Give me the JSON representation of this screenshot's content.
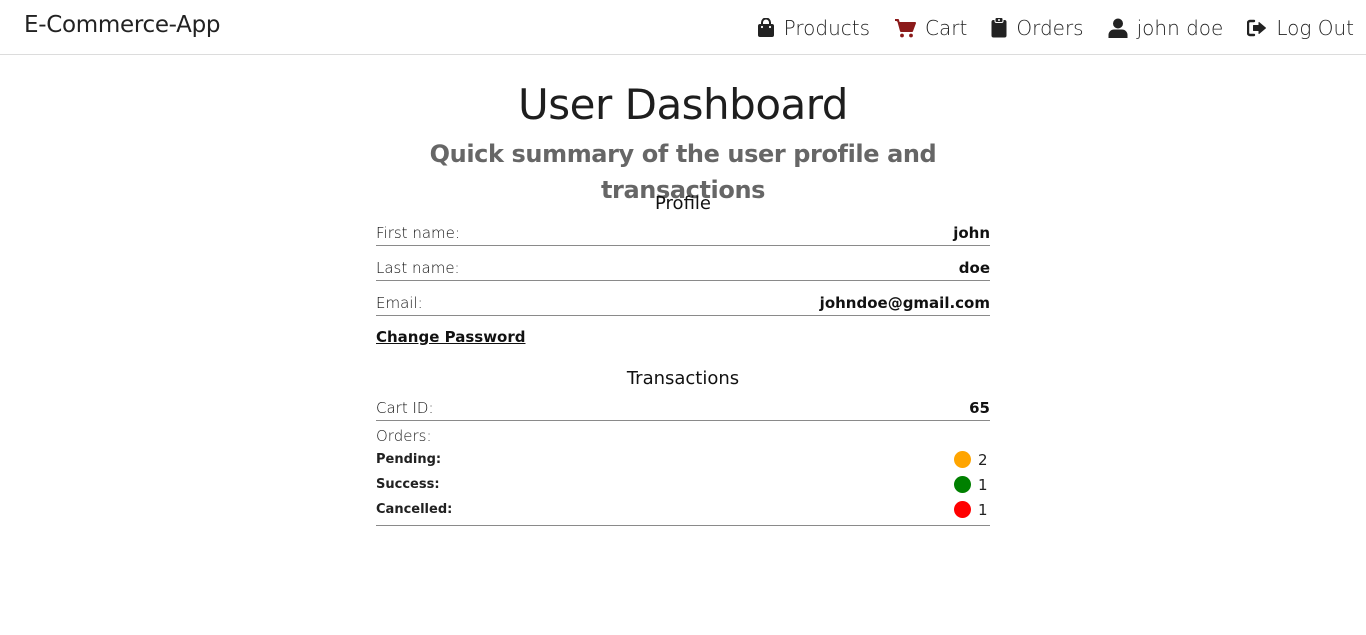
{
  "navbar": {
    "brand": "E-Commerce-App",
    "items": [
      {
        "label": "Products",
        "icon": "shopping-bag-icon"
      },
      {
        "label": "Cart",
        "icon": "cart-icon"
      },
      {
        "label": "Orders",
        "icon": "clipboard-icon"
      },
      {
        "label": "john doe",
        "icon": "user-icon"
      },
      {
        "label": "Log Out",
        "icon": "sign-out-icon"
      }
    ],
    "colors": {
      "cart_icon": "#8b1a1a",
      "text": "#222222"
    }
  },
  "page": {
    "title": "User Dashboard",
    "subtitle": "Quick summary of the user profile and transactions"
  },
  "profile": {
    "heading": "Profile",
    "rows": [
      {
        "label": "First name:",
        "value": "john"
      },
      {
        "label": "Last name:",
        "value": "doe"
      },
      {
        "label": "Email:",
        "value": "johndoe@gmail.com"
      }
    ],
    "change_password": "Change Password"
  },
  "transactions": {
    "heading": "Transactions",
    "cart": {
      "label": "Cart ID:",
      "value": "65"
    },
    "orders_label": "Orders:",
    "statuses": [
      {
        "label": "Pending:",
        "count": "2",
        "color": "#ffa500"
      },
      {
        "label": "Success:",
        "count": "1",
        "color": "#008000"
      },
      {
        "label": "Cancelled:",
        "count": "1",
        "color": "#ff0000"
      }
    ]
  }
}
